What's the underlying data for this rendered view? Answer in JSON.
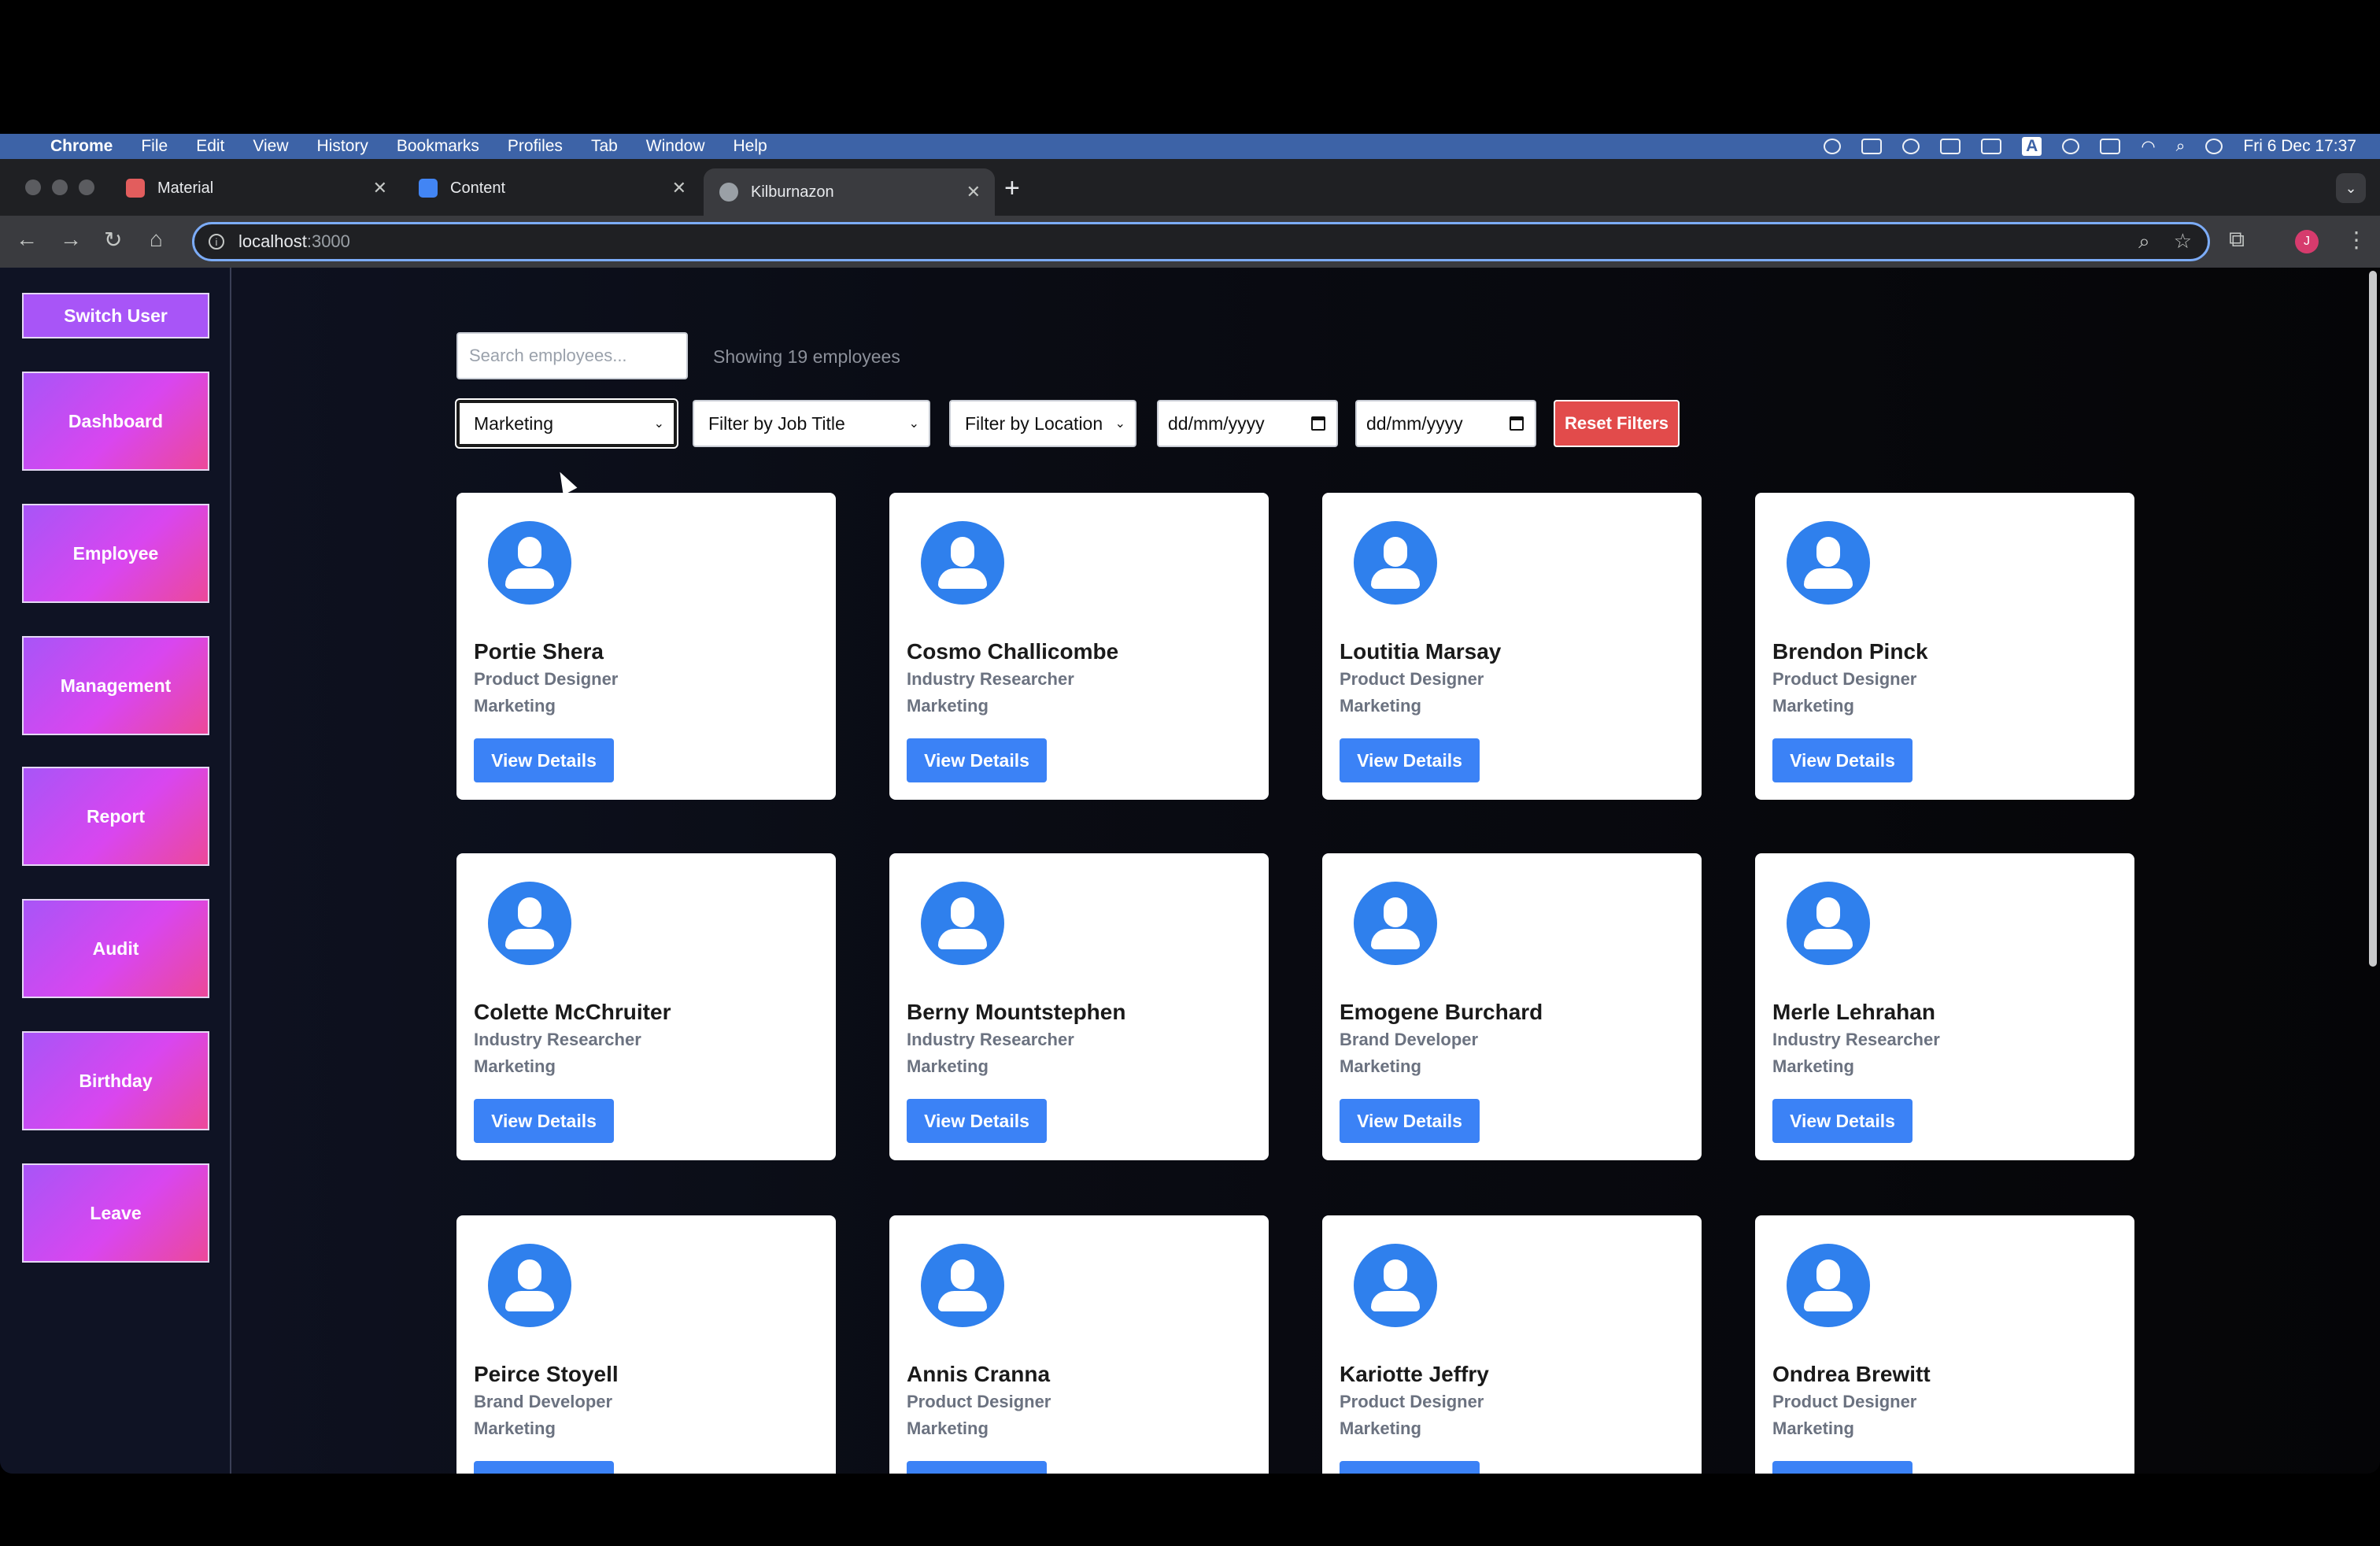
{
  "menubar": {
    "app": "Chrome",
    "items": [
      "File",
      "Edit",
      "View",
      "History",
      "Bookmarks",
      "Profiles",
      "Tab",
      "Window",
      "Help"
    ],
    "datetime": "Fri 6 Dec  17:37",
    "status_icons": [
      "creative-cloud-icon",
      "screen-mirror-icon",
      "app-icon",
      "keyboard-icon",
      "display-icon",
      "input-source-icon",
      "airdrop-icon",
      "battery-icon",
      "wifi-icon",
      "spotlight-icon",
      "control-center-icon"
    ],
    "input_source": "A"
  },
  "tabs": [
    {
      "label": "Material",
      "favicon_color": "#e25d5d",
      "active": false
    },
    {
      "label": "Content",
      "favicon_color": "#4285f4",
      "active": false
    },
    {
      "label": "Kilburnazon",
      "favicon_color": "#9aa0a6",
      "active": true
    }
  ],
  "address": {
    "host": "localhost",
    "port": ":3000"
  },
  "profile_initial": "J",
  "sidebar": {
    "switch_user": "Switch User",
    "items": [
      "Dashboard",
      "Employee",
      "Management",
      "Report",
      "Audit",
      "Birthday",
      "Leave"
    ]
  },
  "filters": {
    "search_placeholder": "Search employees...",
    "count_text": "Showing 19 employees",
    "department": "Marketing",
    "job_title": "Filter by Job Title",
    "location": "Filter by Location",
    "date_from": "dd/mm/yyyy",
    "date_to": "dd/mm/yyyy",
    "reset": "Reset Filters"
  },
  "view_details_label": "View Details",
  "employees": [
    {
      "name": "Portie Shera",
      "title": "Product Designer",
      "dept": "Marketing"
    },
    {
      "name": "Cosmo Challicombe",
      "title": "Industry Researcher",
      "dept": "Marketing"
    },
    {
      "name": "Loutitia Marsay",
      "title": "Product Designer",
      "dept": "Marketing"
    },
    {
      "name": "Brendon Pinck",
      "title": "Product Designer",
      "dept": "Marketing"
    },
    {
      "name": "Colette McChruiter",
      "title": "Industry Researcher",
      "dept": "Marketing"
    },
    {
      "name": "Berny Mountstephen",
      "title": "Industry Researcher",
      "dept": "Marketing"
    },
    {
      "name": "Emogene Burchard",
      "title": "Brand Developer",
      "dept": "Marketing"
    },
    {
      "name": "Merle Lehrahan",
      "title": "Industry Researcher",
      "dept": "Marketing"
    },
    {
      "name": "Peirce Stoyell",
      "title": "Brand Developer",
      "dept": "Marketing"
    },
    {
      "name": "Annis Cranna",
      "title": "Product Designer",
      "dept": "Marketing"
    },
    {
      "name": "Kariotte Jeffry",
      "title": "Product Designer",
      "dept": "Marketing"
    },
    {
      "name": "Ondrea Brewitt",
      "title": "Product Designer",
      "dept": "Marketing"
    }
  ]
}
